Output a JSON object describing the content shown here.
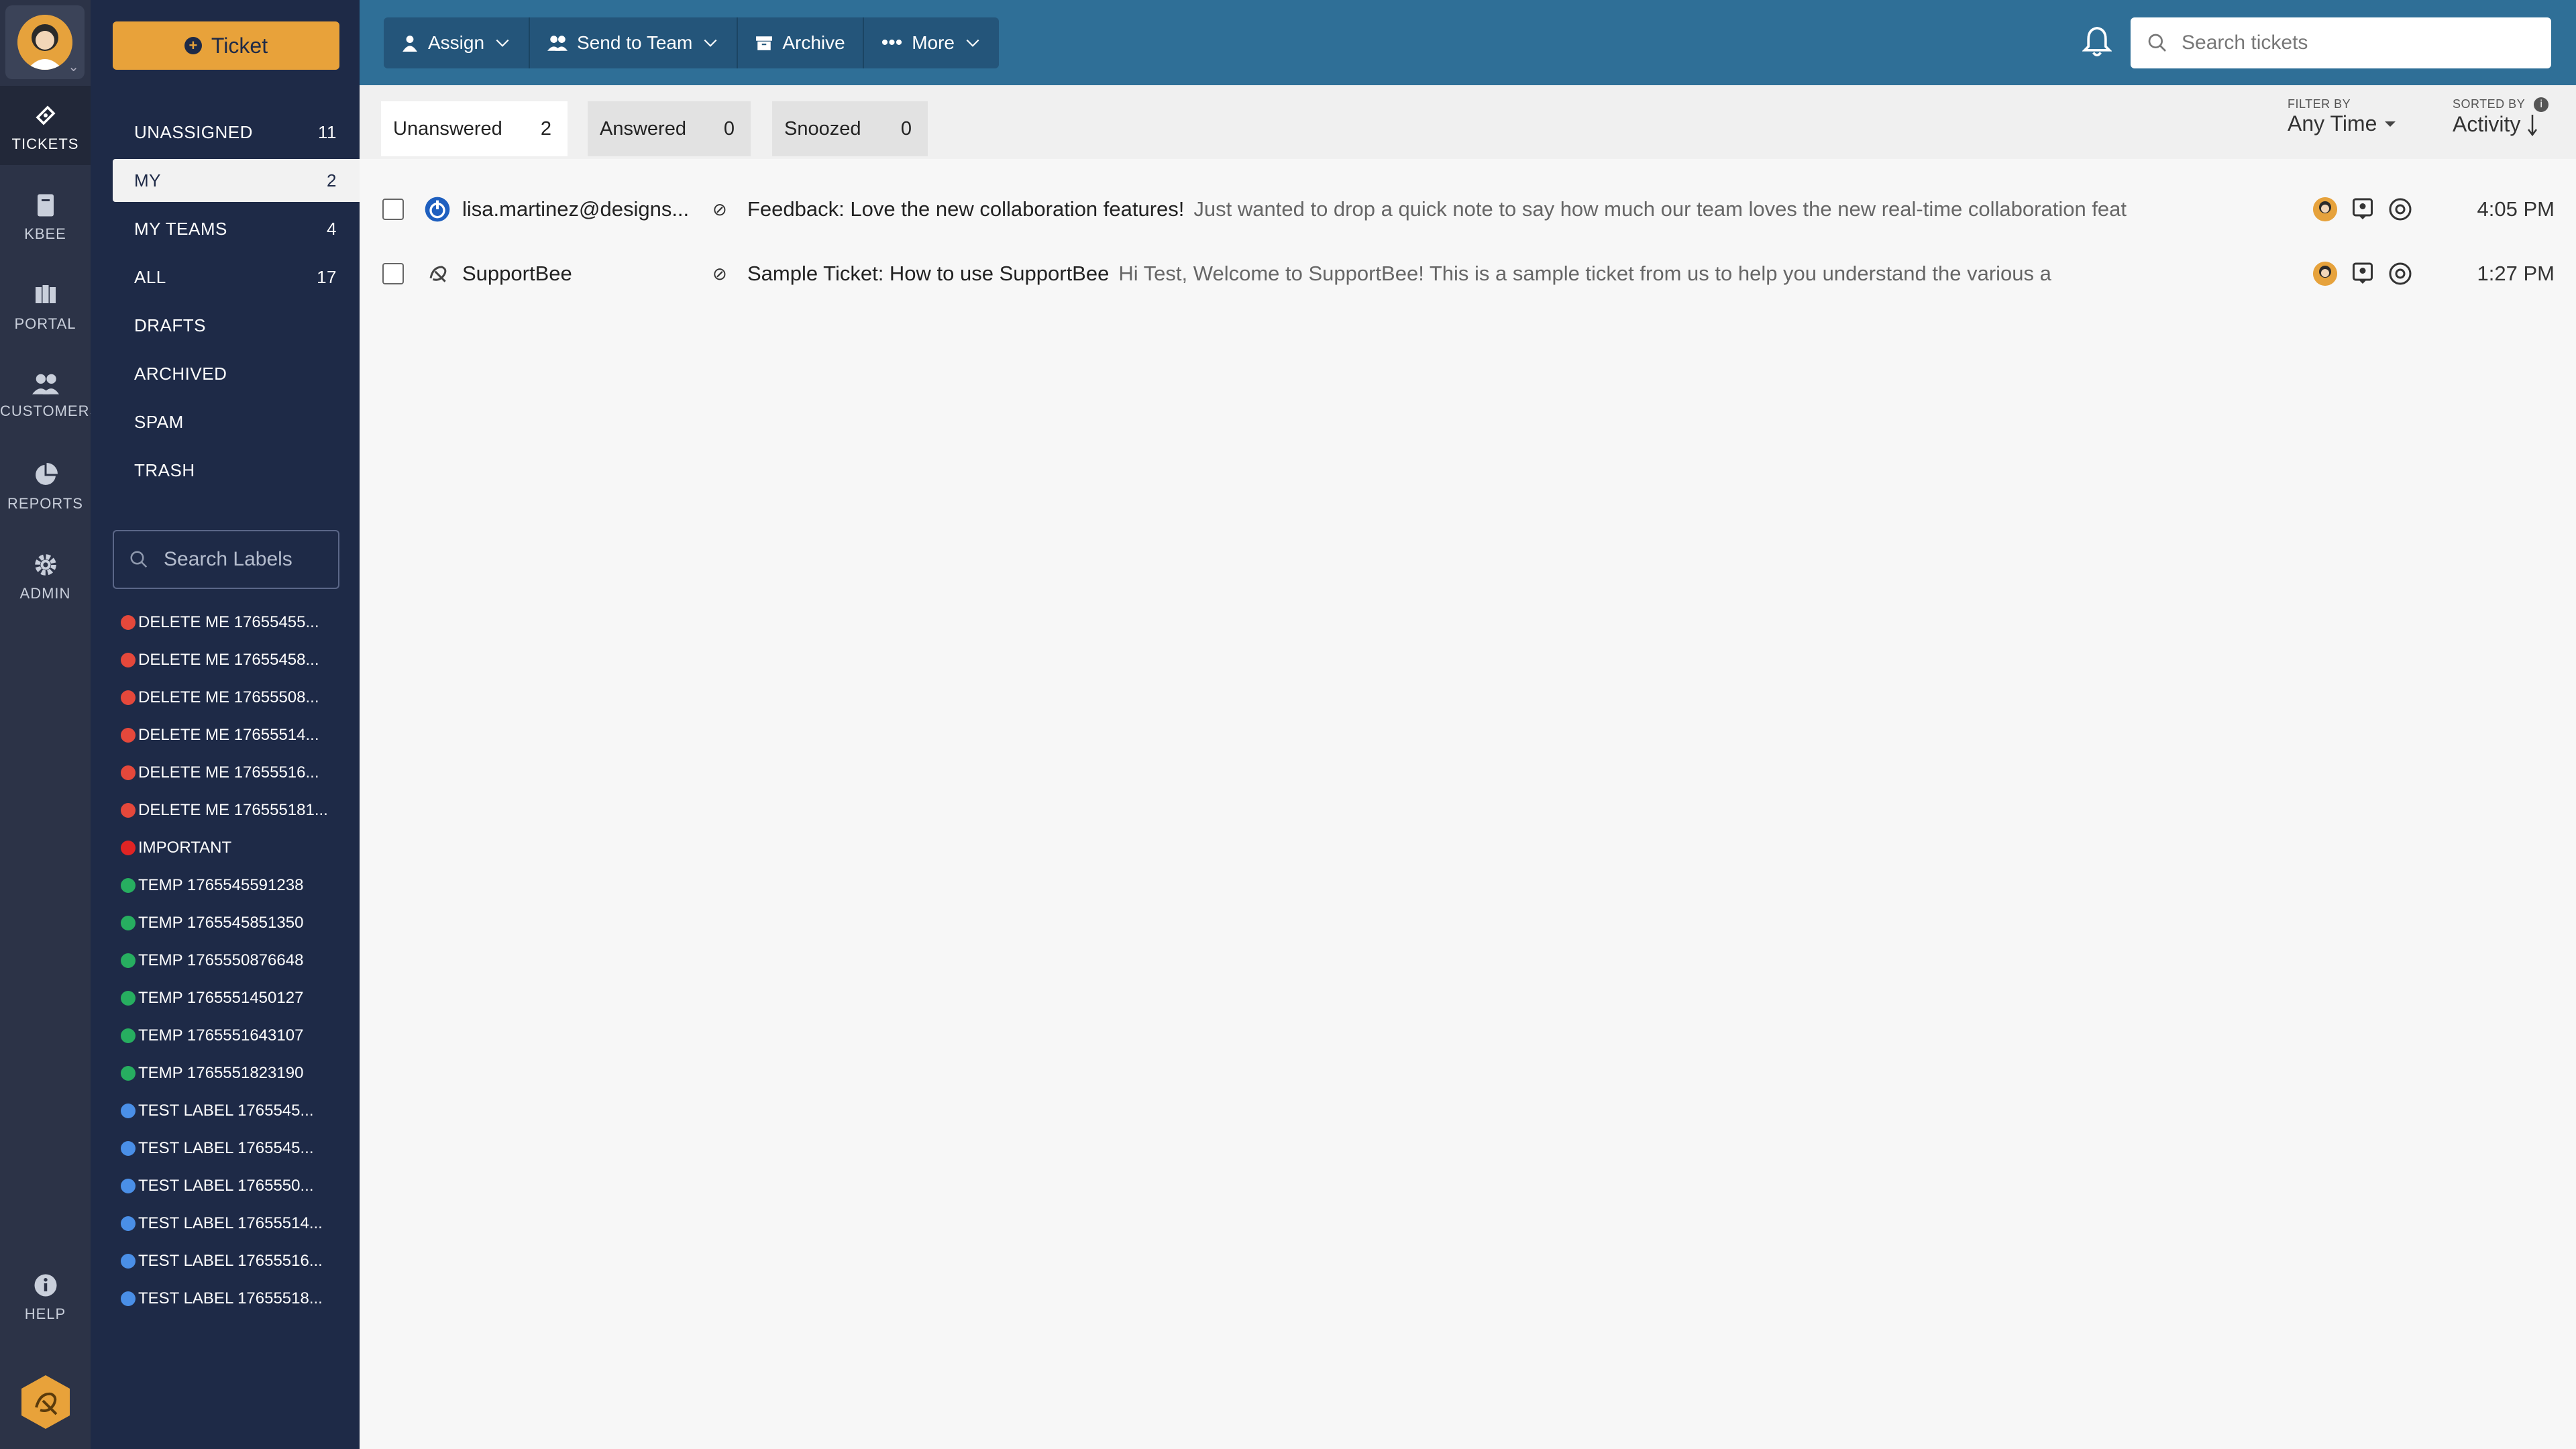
{
  "rail": {
    "items": [
      {
        "label": "TICKETS",
        "icon": "ticket-icon"
      },
      {
        "label": "KBEE",
        "icon": "book-icon"
      },
      {
        "label": "PORTAL",
        "icon": "portal-icon"
      },
      {
        "label": "CUSTOMERS",
        "icon": "customers-icon"
      },
      {
        "label": "REPORTS",
        "icon": "pie-chart-icon"
      },
      {
        "label": "ADMIN",
        "icon": "gear-icon"
      },
      {
        "label": "HELP",
        "icon": "info-icon"
      }
    ]
  },
  "sidebar": {
    "new_ticket_label": "Ticket",
    "folders": [
      {
        "label": "UNASSIGNED",
        "count": "11"
      },
      {
        "label": "MY",
        "count": "2"
      },
      {
        "label": "MY TEAMS",
        "count": "4"
      },
      {
        "label": "ALL",
        "count": "17"
      },
      {
        "label": "DRAFTS",
        "count": ""
      },
      {
        "label": "ARCHIVED",
        "count": ""
      },
      {
        "label": "SPAM",
        "count": ""
      },
      {
        "label": "TRASH",
        "count": ""
      }
    ],
    "label_search_placeholder": "Search Labels",
    "labels": [
      {
        "name": "DELETE ME 17655455...",
        "color": "#e5483b"
      },
      {
        "name": "DELETE ME 17655458...",
        "color": "#e5483b"
      },
      {
        "name": "DELETE ME 17655508...",
        "color": "#e5483b"
      },
      {
        "name": "DELETE ME 17655514...",
        "color": "#e5483b"
      },
      {
        "name": "DELETE ME 17655516...",
        "color": "#e5483b"
      },
      {
        "name": "DELETE ME 176555181...",
        "color": "#e5483b"
      },
      {
        "name": "IMPORTANT",
        "color": "#e02424"
      },
      {
        "name": "TEMP 1765545591238",
        "color": "#27ae60"
      },
      {
        "name": "TEMP 1765545851350",
        "color": "#27ae60"
      },
      {
        "name": "TEMP 1765550876648",
        "color": "#27ae60"
      },
      {
        "name": "TEMP 1765551450127",
        "color": "#27ae60"
      },
      {
        "name": "TEMP 1765551643107",
        "color": "#27ae60"
      },
      {
        "name": "TEMP 1765551823190",
        "color": "#27ae60"
      },
      {
        "name": "TEST LABEL 1765545...",
        "color": "#4a8fe7"
      },
      {
        "name": "TEST LABEL 1765545...",
        "color": "#4a8fe7"
      },
      {
        "name": "TEST LABEL 1765550...",
        "color": "#4a8fe7"
      },
      {
        "name": "TEST LABEL 17655514...",
        "color": "#4a8fe7"
      },
      {
        "name": "TEST LABEL 17655516...",
        "color": "#4a8fe7"
      },
      {
        "name": "TEST LABEL 17655518...",
        "color": "#4a8fe7"
      }
    ]
  },
  "toolbar": {
    "assign": "Assign",
    "send_to_team": "Send to Team",
    "archive": "Archive",
    "more": "More",
    "search_placeholder": "Search tickets"
  },
  "tabs": [
    {
      "label": "Unanswered",
      "count": "2"
    },
    {
      "label": "Answered",
      "count": "0"
    },
    {
      "label": "Snoozed",
      "count": "0"
    }
  ],
  "filter": {
    "filter_caption": "FILTER BY",
    "filter_value": "Any Time",
    "sort_caption": "SORTED BY",
    "sort_value": "Activity"
  },
  "tickets": [
    {
      "requester": "lisa.martinez@designs...",
      "subject": "Feedback: Love the new collaboration features!",
      "preview": "Just wanted to drop a quick note to say how much our team loves the new real-time collaboration feat",
      "time": "4:05 PM"
    },
    {
      "requester": "SupportBee",
      "subject": "Sample Ticket: How to use SupportBee",
      "preview": "Hi Test, Welcome to SupportBee! This is a sample ticket from us to help you understand the various a",
      "time": "1:27 PM"
    }
  ],
  "colors": {
    "rail_bg": "#2c3347",
    "sidebar_bg": "#1e2a47",
    "topbar_bg": "#2f6f97",
    "accent": "#e8a23a"
  }
}
